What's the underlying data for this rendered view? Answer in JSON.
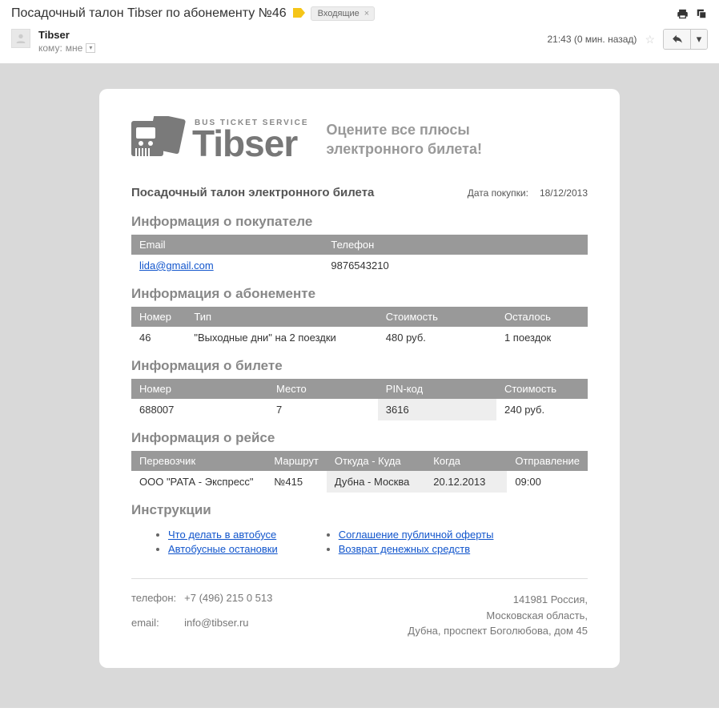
{
  "chrome": {
    "subject": "Посадочный талон Tibser по абонементу №46",
    "inbox_label": "Входящие",
    "sender": "Tibser",
    "to_label": "кому:",
    "to_value": "мне",
    "time": "21:43 (0 мин. назад)"
  },
  "card": {
    "logo_sub": "BUS TICKET SERVICE",
    "logo_main": "Tibser",
    "tagline_l1": "Оцените все плюсы",
    "tagline_l2": "электронного билета!",
    "doc_title": "Посадочный талон электронного билета",
    "date_label": "Дата покупки:",
    "date_value": "18/12/2013"
  },
  "buyer": {
    "heading": "Информация о покупателе",
    "cols": {
      "email": "Email",
      "phone": "Телефон"
    },
    "email": "lida@gmail.com",
    "phone": "9876543210"
  },
  "subscription": {
    "heading": "Информация о абонементе",
    "cols": {
      "num": "Номер",
      "type": "Тип",
      "cost": "Стоимость",
      "left": "Осталось"
    },
    "num": "46",
    "type": "\"Выходные дни\" на 2 поездки",
    "cost": "480 руб.",
    "left": "1 поездок"
  },
  "ticket": {
    "heading": "Информация о билете",
    "cols": {
      "num": "Номер",
      "seat": "Место",
      "pin": "PIN-код",
      "cost": "Стоимость"
    },
    "num": "688007",
    "seat": "7",
    "pin": "3616",
    "cost": "240 руб."
  },
  "trip": {
    "heading": "Информация о рейсе",
    "cols": {
      "carrier": "Перевозчик",
      "route": "Маршрут",
      "fromto": "Откуда - Куда",
      "when": "Когда",
      "dep": "Отправление"
    },
    "carrier": "ООО \"РАТА - Экспресс\"",
    "route": "№415",
    "fromto": "Дубна - Москва",
    "when": "20.12.2013",
    "dep": "09:00"
  },
  "instructions": {
    "heading": "Инструкции",
    "left": {
      "0": "Что делать в автобусе",
      "1": "Автобусные остановки"
    },
    "right": {
      "0": "Соглашение публичной оферты",
      "1": "Возврат денежных средств"
    }
  },
  "footer": {
    "phone_label": "телефон:",
    "phone": "+7 (496) 215 0 513",
    "email_label": "email:",
    "email": "info@tibser.ru",
    "addr1": "141981 Россия,",
    "addr2": "Московская область,",
    "addr3": "Дубна, проспект Боголюбова, дом 45"
  }
}
